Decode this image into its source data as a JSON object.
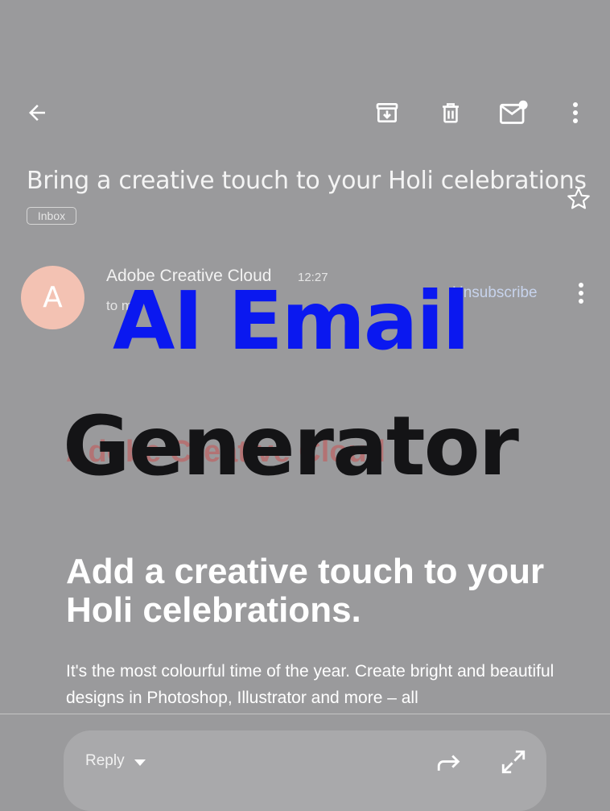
{
  "toolbar": {
    "icons": [
      "back-arrow-icon",
      "archive-icon",
      "delete-icon",
      "mark-unread-icon",
      "more-vert-icon"
    ]
  },
  "email": {
    "subject": "Bring a creative touch to your Holi celebrations",
    "label": "Inbox",
    "sender_initial": "A",
    "sender": "Adobe Creative Cloud",
    "time": "12:27",
    "recipient": "to me",
    "unsubscribe": "Unsubscribe",
    "logo_text": "Adobe Creative Cloud",
    "headline": "Add a creative touch to your Holi celebrations.",
    "body": "It's the most colourful time of the year. Create bright and beautiful designs in Photoshop, Illustrator and more – all"
  },
  "overlay": {
    "title_line1": "AI Email",
    "title_line2": "Generator",
    "title_color": "#0a18f0"
  },
  "reply_bar": {
    "reply_label": "Reply"
  },
  "colors": {
    "background": "#9a9a9c",
    "avatar": "#f3c2b3",
    "unsubscribe": "#c7d3ec"
  }
}
